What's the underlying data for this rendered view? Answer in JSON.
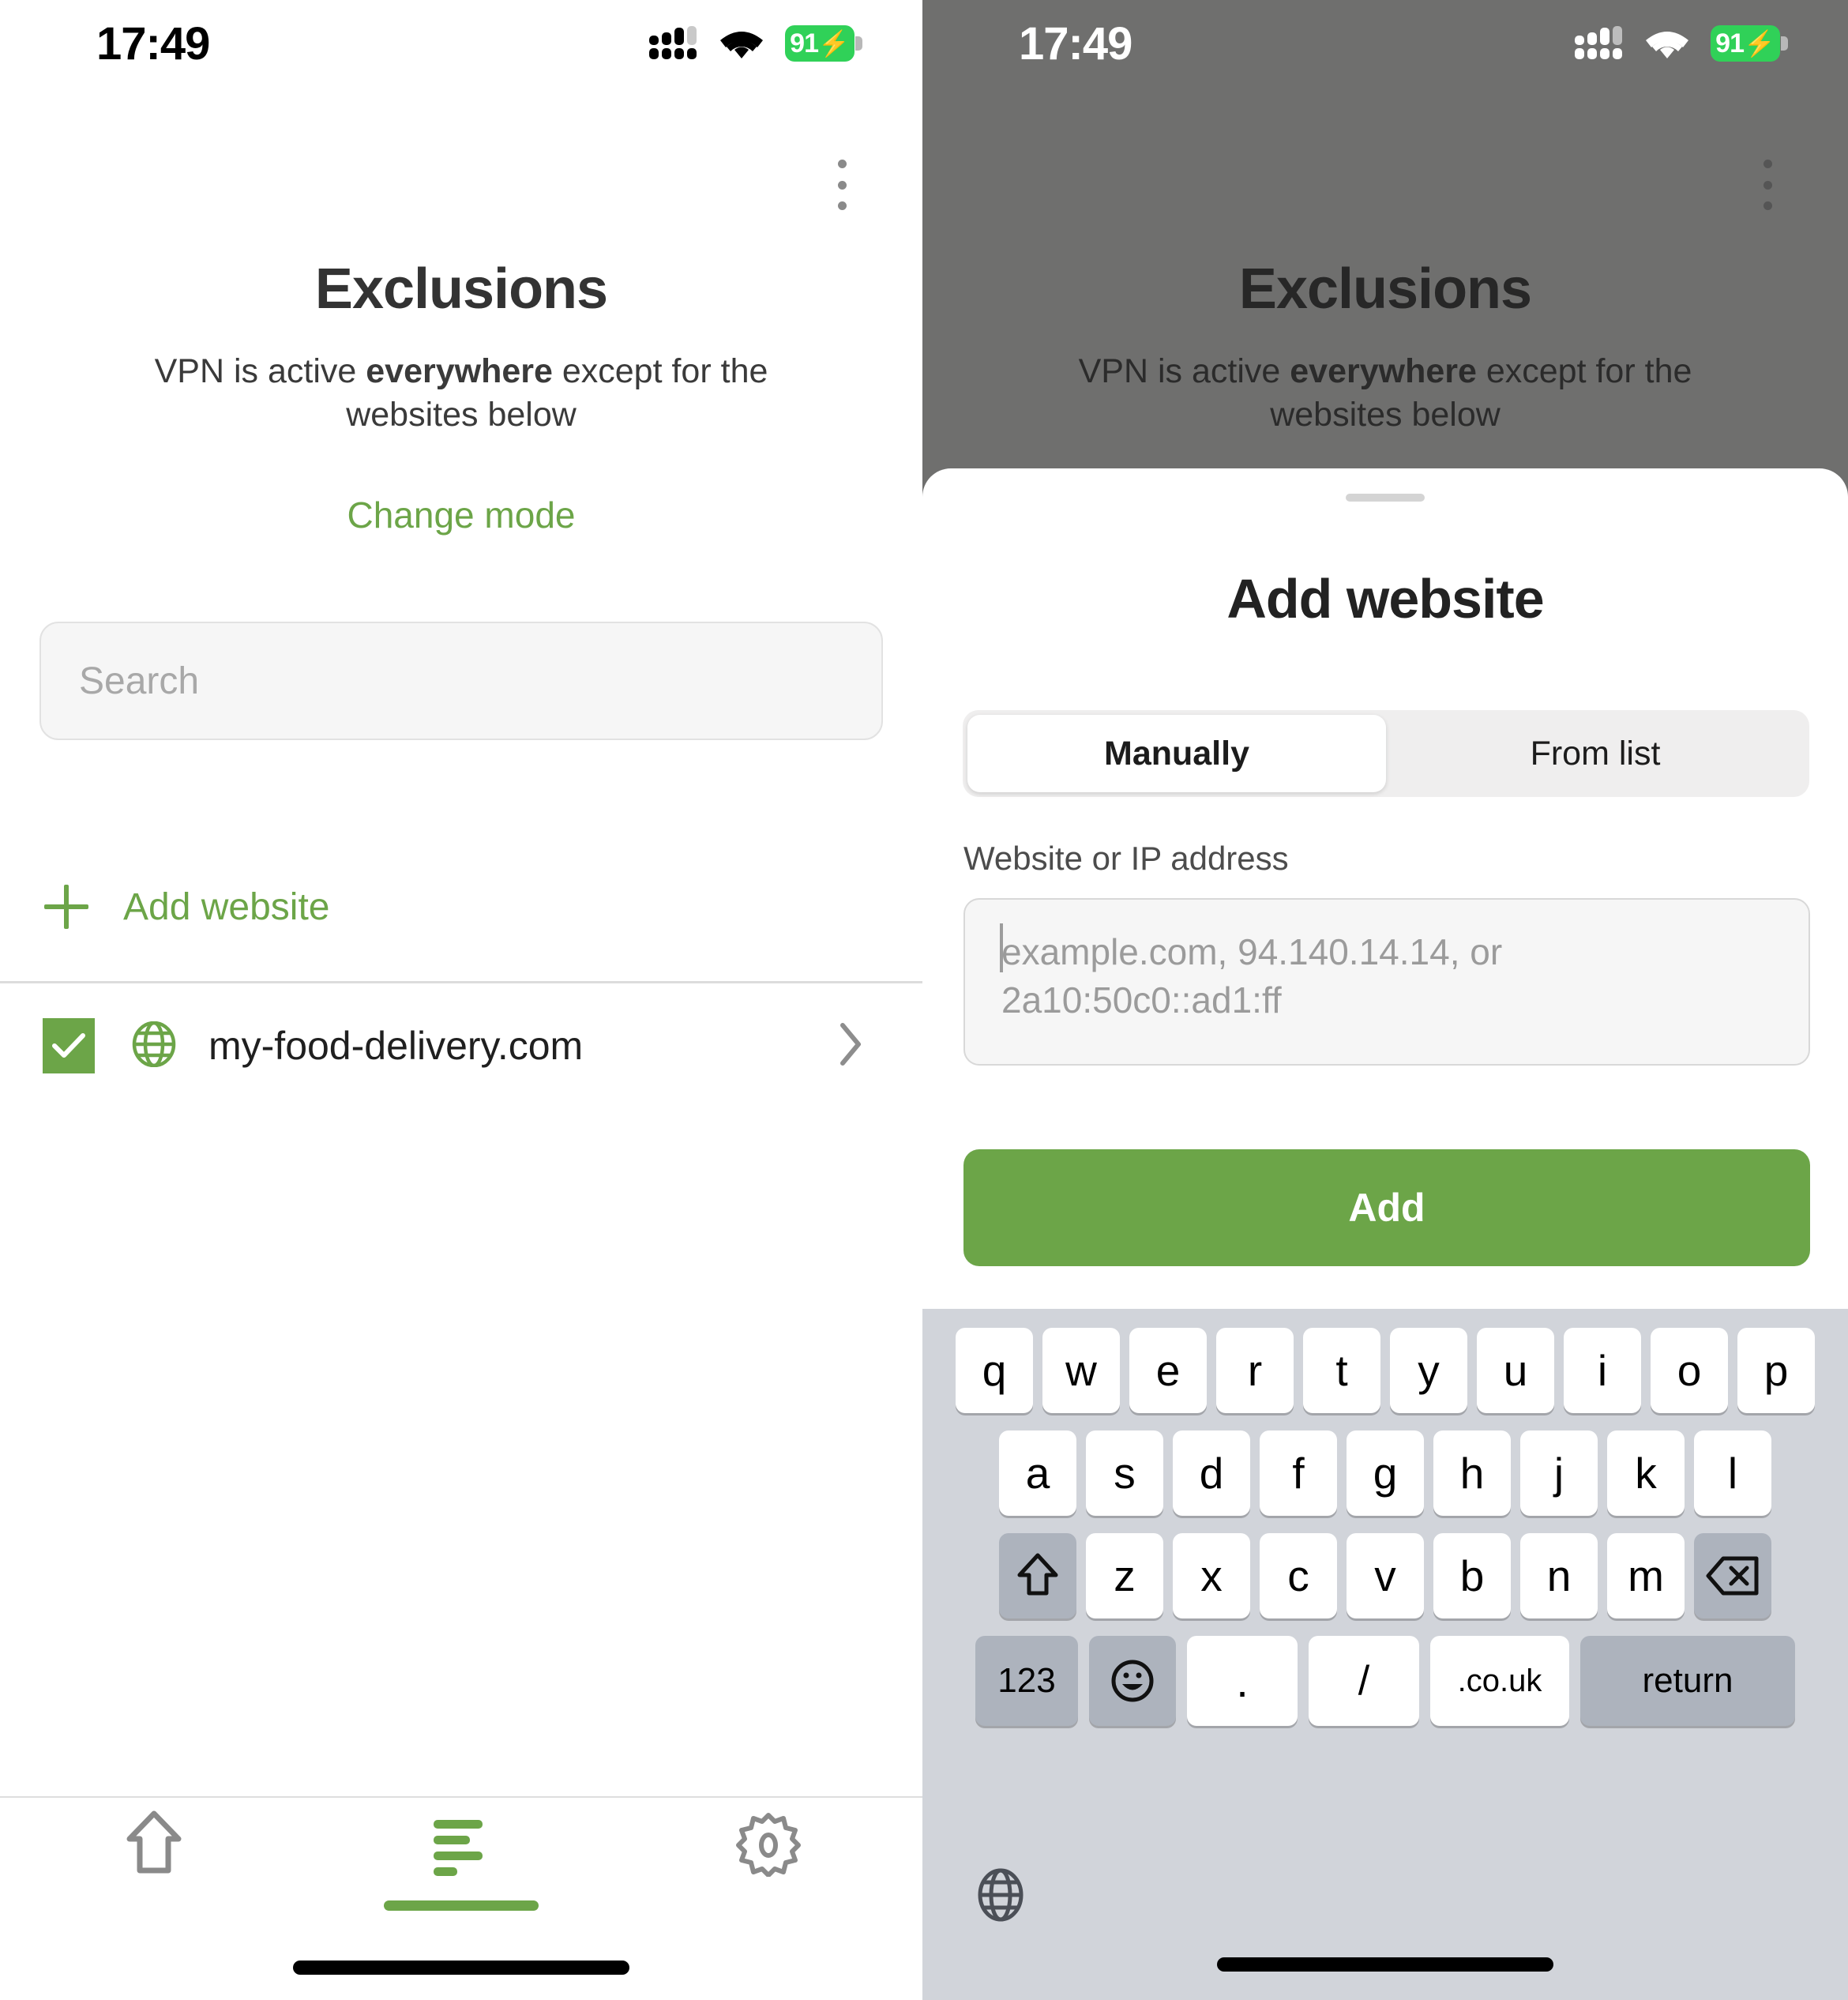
{
  "status_bar": {
    "time": "17:49",
    "battery_level": "91",
    "battery_charging_icon": "bolt-icon",
    "cellular_icon": "cellular-signal-icon",
    "wifi_icon": "wifi-icon",
    "battery_color": "#30d158"
  },
  "exclusions_screen": {
    "menu_icon": "kebab-menu-icon",
    "title": "Exclusions",
    "subtitle_prefix": "VPN is active ",
    "subtitle_bold": "everywhere",
    "subtitle_suffix": " except for the websites below",
    "change_mode_label": "Change mode",
    "accent_color": "#6ca548",
    "search": {
      "placeholder": "Search",
      "icon": "search-input"
    },
    "add_website": {
      "icon": "plus-icon",
      "label": "Add website"
    },
    "sites": [
      {
        "name": "my-food-delivery.com",
        "checked": true,
        "check_icon": "checkmark-icon",
        "site_icon": "globe-icon",
        "chevron_icon": "chevron-right-icon"
      }
    ],
    "tabs": [
      {
        "name": "home",
        "icon": "home-arrow-icon",
        "active": false
      },
      {
        "name": "exclusions",
        "icon": "list-lines-icon",
        "active": true
      },
      {
        "name": "settings",
        "icon": "gear-icon",
        "active": false
      }
    ]
  },
  "add_website_sheet": {
    "grabber": "sheet-grabber",
    "title": "Add website",
    "segments": [
      {
        "label": "Manually",
        "active": true
      },
      {
        "label": "From list",
        "active": false
      }
    ],
    "field_label": "Website or IP address",
    "field_value": "",
    "field_placeholder": "example.com, 94.140.14.14, or 2a10:50c0::ad1:ff",
    "submit_label": "Add",
    "submit_color": "#6ca548"
  },
  "keyboard": {
    "row1": [
      "q",
      "w",
      "e",
      "r",
      "t",
      "y",
      "u",
      "i",
      "o",
      "p"
    ],
    "row2": [
      "a",
      "s",
      "d",
      "f",
      "g",
      "h",
      "j",
      "k",
      "l"
    ],
    "row3": [
      "z",
      "x",
      "c",
      "v",
      "b",
      "n",
      "m"
    ],
    "shift_icon": "shift-up-arrow-icon",
    "backspace_icon": "backspace-delete-icon",
    "numbers_key": "123",
    "emoji_icon": "emoji-smiley-icon",
    "period_key": ".",
    "slash_key": "/",
    "tld_key": ".co.uk",
    "return_key": "return",
    "globe_icon": "globe-language-icon"
  }
}
